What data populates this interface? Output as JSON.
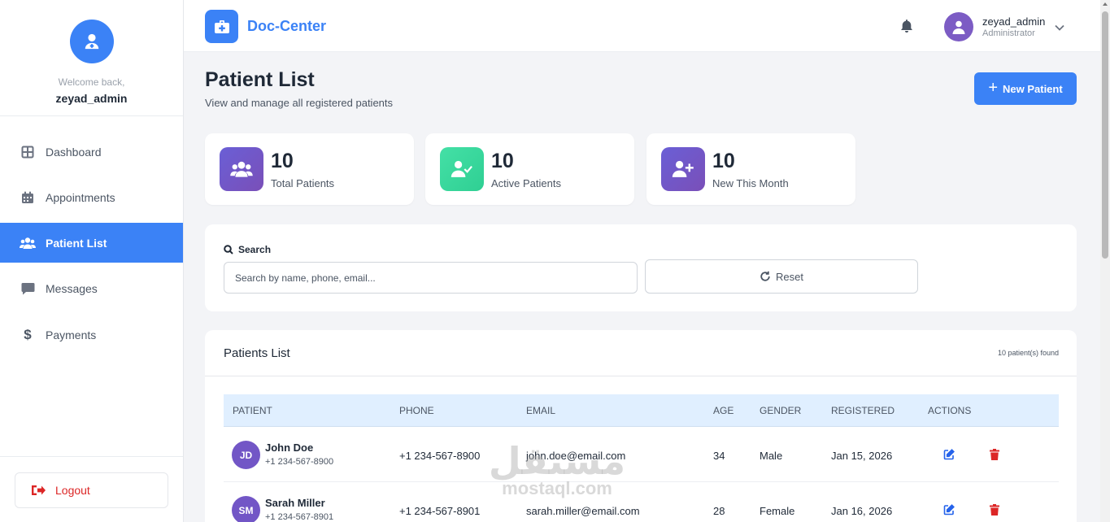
{
  "sidebar": {
    "welcome": "Welcome back,",
    "username": "zeyad_admin",
    "items": [
      {
        "label": "Dashboard",
        "icon": "grid-icon"
      },
      {
        "label": "Appointments",
        "icon": "calendar-icon"
      },
      {
        "label": "Patient List",
        "icon": "users-icon",
        "active": true
      },
      {
        "label": "Messages",
        "icon": "message-icon"
      },
      {
        "label": "Payments",
        "icon": "dollar-icon"
      }
    ],
    "logout_label": "Logout"
  },
  "topbar": {
    "brand": "Doc-Center",
    "user_name": "zeyad_admin",
    "user_role": "Administrator"
  },
  "page": {
    "title": "Patient List",
    "subtitle": "View and manage all registered patients",
    "new_button": "New Patient"
  },
  "stats": [
    {
      "value": "10",
      "label": "Total Patients",
      "icon": "users-icon",
      "color": "#6d4fc2"
    },
    {
      "value": "10",
      "label": "Active Patients",
      "icon": "user-check-icon",
      "color": "#34d399"
    },
    {
      "value": "10",
      "label": "New This Month",
      "icon": "user-plus-icon",
      "color": "#6d4fc2"
    }
  ],
  "search": {
    "label": "Search",
    "placeholder": "Search by name, phone, email...",
    "reset_label": "Reset"
  },
  "table": {
    "title": "Patients List",
    "count_text": "10 patient(s) found",
    "headers": [
      "PATIENT",
      "PHONE",
      "EMAIL",
      "AGE",
      "GENDER",
      "REGISTERED",
      "ACTIONS"
    ],
    "rows": [
      {
        "initials": "JD",
        "name": "John Doe",
        "sub_phone": "+1 234-567-8900",
        "phone": "+1 234-567-8900",
        "email": "john.doe@email.com",
        "age": "34",
        "gender": "Male",
        "registered": "Jan 15, 2026"
      },
      {
        "initials": "SM",
        "name": "Sarah Miller",
        "sub_phone": "+1 234-567-8901",
        "phone": "+1 234-567-8901",
        "email": "sarah.miller@email.com",
        "age": "28",
        "gender": "Female",
        "registered": "Jan 16, 2026"
      }
    ]
  },
  "watermark": {
    "arabic": "مستقل",
    "latin": "mostaql.com"
  },
  "colors": {
    "primary": "#3b82f6",
    "danger": "#dc2626",
    "avatar": "#7256c6"
  }
}
